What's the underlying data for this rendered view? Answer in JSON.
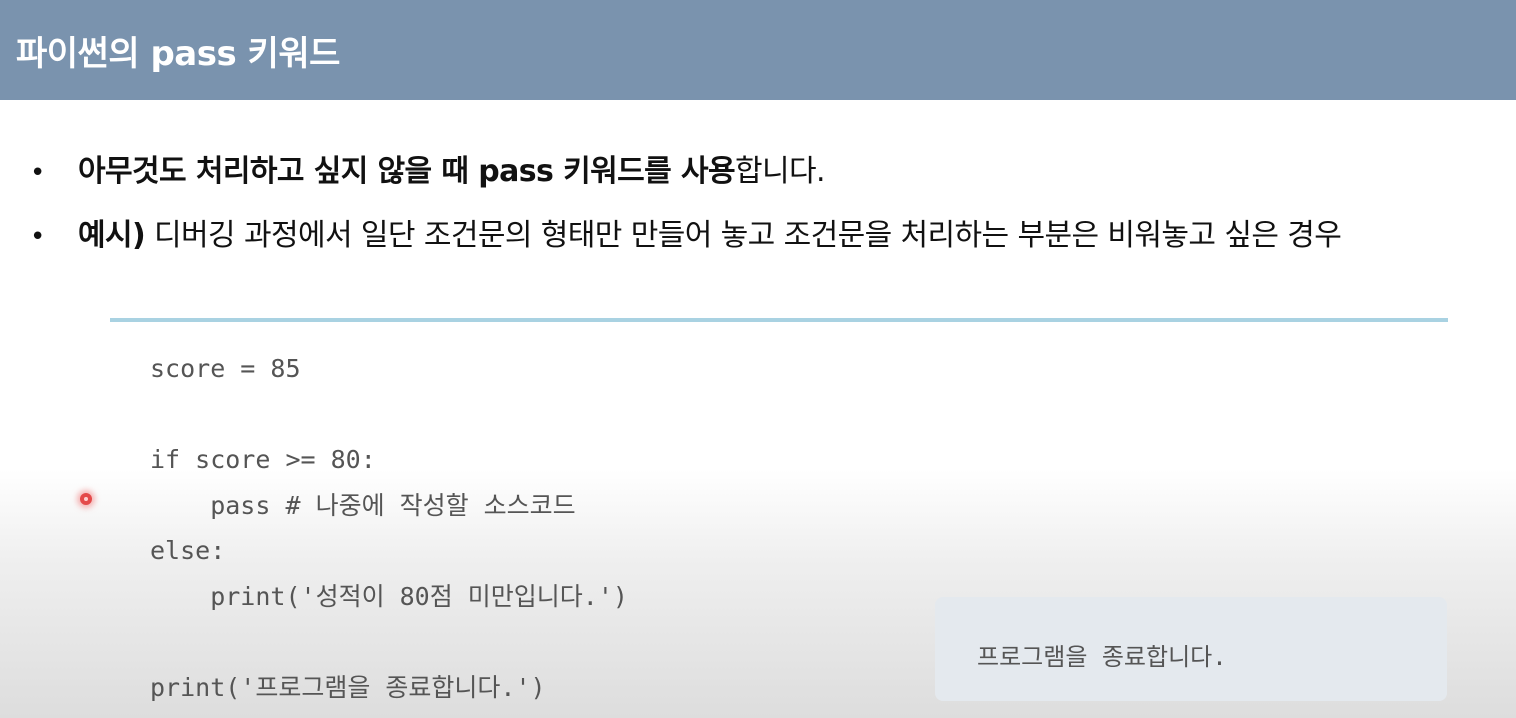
{
  "header": {
    "title": "파이썬의 pass 키워드"
  },
  "bullets": [
    {
      "marker": "•",
      "bold_text": "아무것도 처리하고 싶지 않을 때 pass 키워드를 사용",
      "normal_text": "합니다."
    },
    {
      "marker": "•",
      "bold_text": "예시)",
      "normal_text": " 디버깅 과정에서 일단 조건문의 형태만 만들어 놓고 조건문을 처리하는 부분은 비워놓고 싶은 경우"
    }
  ],
  "code": {
    "lines": [
      "score = 85",
      "",
      "if score >= 80:",
      "    pass # 나중에 작성할 소스코드",
      "else:",
      "    print('성적이 80점 미만입니다.')",
      "",
      "print('프로그램을 종료합니다.')"
    ],
    "colors": {
      "rule": "#a9d2e2",
      "text": "#555555"
    }
  },
  "output": {
    "text": "프로그램을 종료합니다."
  },
  "colors": {
    "header_bg": "#7a93ae",
    "header_text": "#ffffff",
    "output_bg": "#e4e9ee",
    "cursor": "#e44a4a"
  }
}
